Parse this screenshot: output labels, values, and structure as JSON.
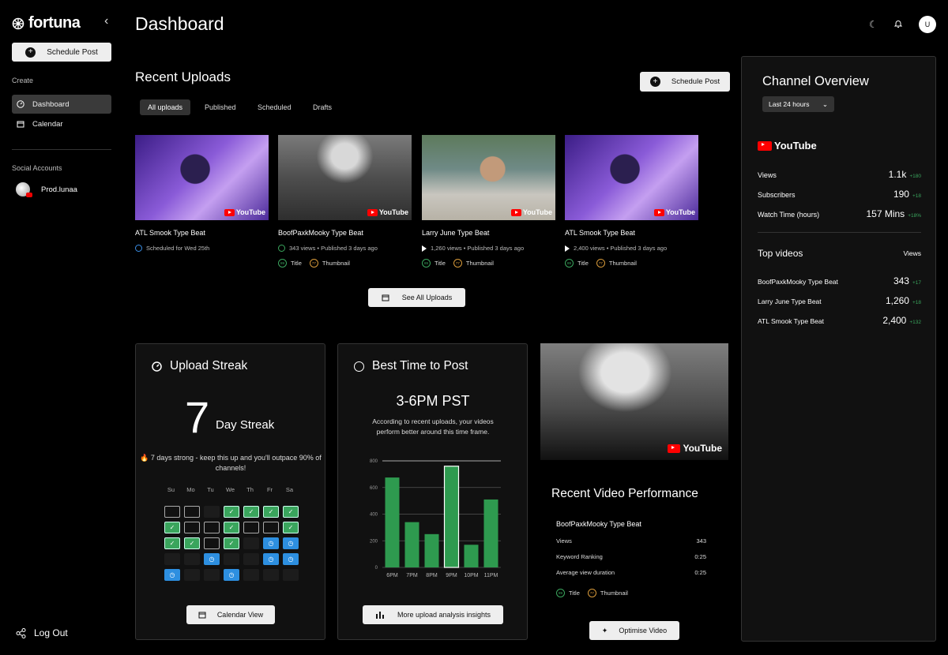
{
  "app": {
    "name": "fortuna",
    "page_title": "Dashboard"
  },
  "sidebar": {
    "schedule_label": "Schedule Post",
    "create_heading": "Create",
    "items": [
      {
        "label": "Dashboard",
        "icon": "gauge-icon",
        "active": true
      },
      {
        "label": "Calendar",
        "icon": "calendar-icon",
        "active": false
      }
    ],
    "accounts_heading": "Social Accounts",
    "account_name": "Prod.lunaa",
    "logout_label": "Log Out"
  },
  "header": {
    "user_initial": "U"
  },
  "uploads": {
    "title": "Recent Uploads",
    "schedule_label": "Schedule Post",
    "tabs": [
      "All uploads",
      "Published",
      "Scheduled",
      "Drafts"
    ],
    "cards": [
      {
        "title": "ATL Smook Type Beat",
        "meta": "Scheduled for Wed 25th",
        "status": "scheduled"
      },
      {
        "title": "BoofPaxkMooky Type Beat",
        "meta": "343 views • Published 3 days ago",
        "status": "published-check",
        "tag1": "Title",
        "tag2": "Thumbnail"
      },
      {
        "title": "Larry June Type Beat",
        "meta": "1,260 views • Published 3 days ago",
        "status": "published",
        "tag1": "Title",
        "tag2": "Thumbnail"
      },
      {
        "title": "ATL Smook Type Beat",
        "meta": "2,400 views • Published 3 days ago",
        "status": "published",
        "tag1": "Title",
        "tag2": "Thumbnail"
      }
    ],
    "tag_scores": [
      "89",
      "77"
    ],
    "thumb_brand": "YouTube",
    "see_all_label": "See All Uploads"
  },
  "streak": {
    "title": "Upload Streak",
    "count": "7",
    "label": "Day Streak",
    "message": "🔥 7 days strong - keep this up and you'll outpace 90% of channels!",
    "days": [
      "Su",
      "Mo",
      "Tu",
      "We",
      "Th",
      "Fr",
      "Sa"
    ],
    "cells": [
      "empty",
      "empty",
      "none",
      "done",
      "done",
      "done",
      "done",
      "done",
      "empty",
      "empty",
      "done",
      "empty",
      "empty",
      "done",
      "done",
      "done",
      "empty",
      "done",
      "none",
      "plan",
      "plan",
      "none",
      "none",
      "plan",
      "none",
      "none",
      "plan",
      "plan",
      "plan",
      "none",
      "none",
      "plan",
      "none",
      "none",
      "none"
    ],
    "button_label": "Calendar View"
  },
  "best_time": {
    "title": "Best Time to Post",
    "value": "3-6PM PST",
    "description": "According to recent uploads, your videos perform better around this time frame.",
    "button_label": "More upload analysis insights"
  },
  "chart_data": {
    "type": "bar",
    "categories": [
      "6PM",
      "7PM",
      "8PM",
      "9PM",
      "10PM",
      "11PM"
    ],
    "values": [
      675,
      340,
      250,
      760,
      170,
      510
    ],
    "highlight_index": 3,
    "ylim": [
      0,
      800
    ],
    "yticks": [
      0,
      200,
      400,
      600,
      800
    ],
    "color": "#2e9a4f",
    "grid": true
  },
  "performance": {
    "title": "Recent Video Performance",
    "video_title": "BoofPaxkMooky Type Beat",
    "rows": [
      {
        "label": "Views",
        "value": "343"
      },
      {
        "label": "Keyword Ranking",
        "value": "0:25"
      },
      {
        "label": "Average view duration",
        "value": "0:25"
      }
    ],
    "tag1": "Title",
    "tag2": "Thumbnail",
    "button_label": "Optimise Video",
    "brand": "YouTube"
  },
  "overview": {
    "title": "Channel Overview",
    "range": "Last 24 hours",
    "platform": "YouTube",
    "stats": [
      {
        "label": "Views",
        "value": "1.1k",
        "delta": "+180"
      },
      {
        "label": "Subscribers",
        "value": "190",
        "delta": "+18"
      },
      {
        "label": "Watch Time (hours)",
        "value": "157 Mins",
        "delta": "+18%"
      }
    ],
    "top_title": "Top videos",
    "top_col": "Views",
    "top_videos": [
      {
        "title": "BoofPaxkMooky Type Beat",
        "value": "343",
        "delta": "+17"
      },
      {
        "title": "Larry June Type Beat",
        "value": "1,260",
        "delta": "+18"
      },
      {
        "title": "ATL Smook Type Beat",
        "value": "2,400",
        "delta": "+132"
      }
    ]
  },
  "colors": {
    "accent_green": "#3aa55d",
    "accent_blue": "#2d8fe0",
    "youtube_red": "#ff0000"
  }
}
